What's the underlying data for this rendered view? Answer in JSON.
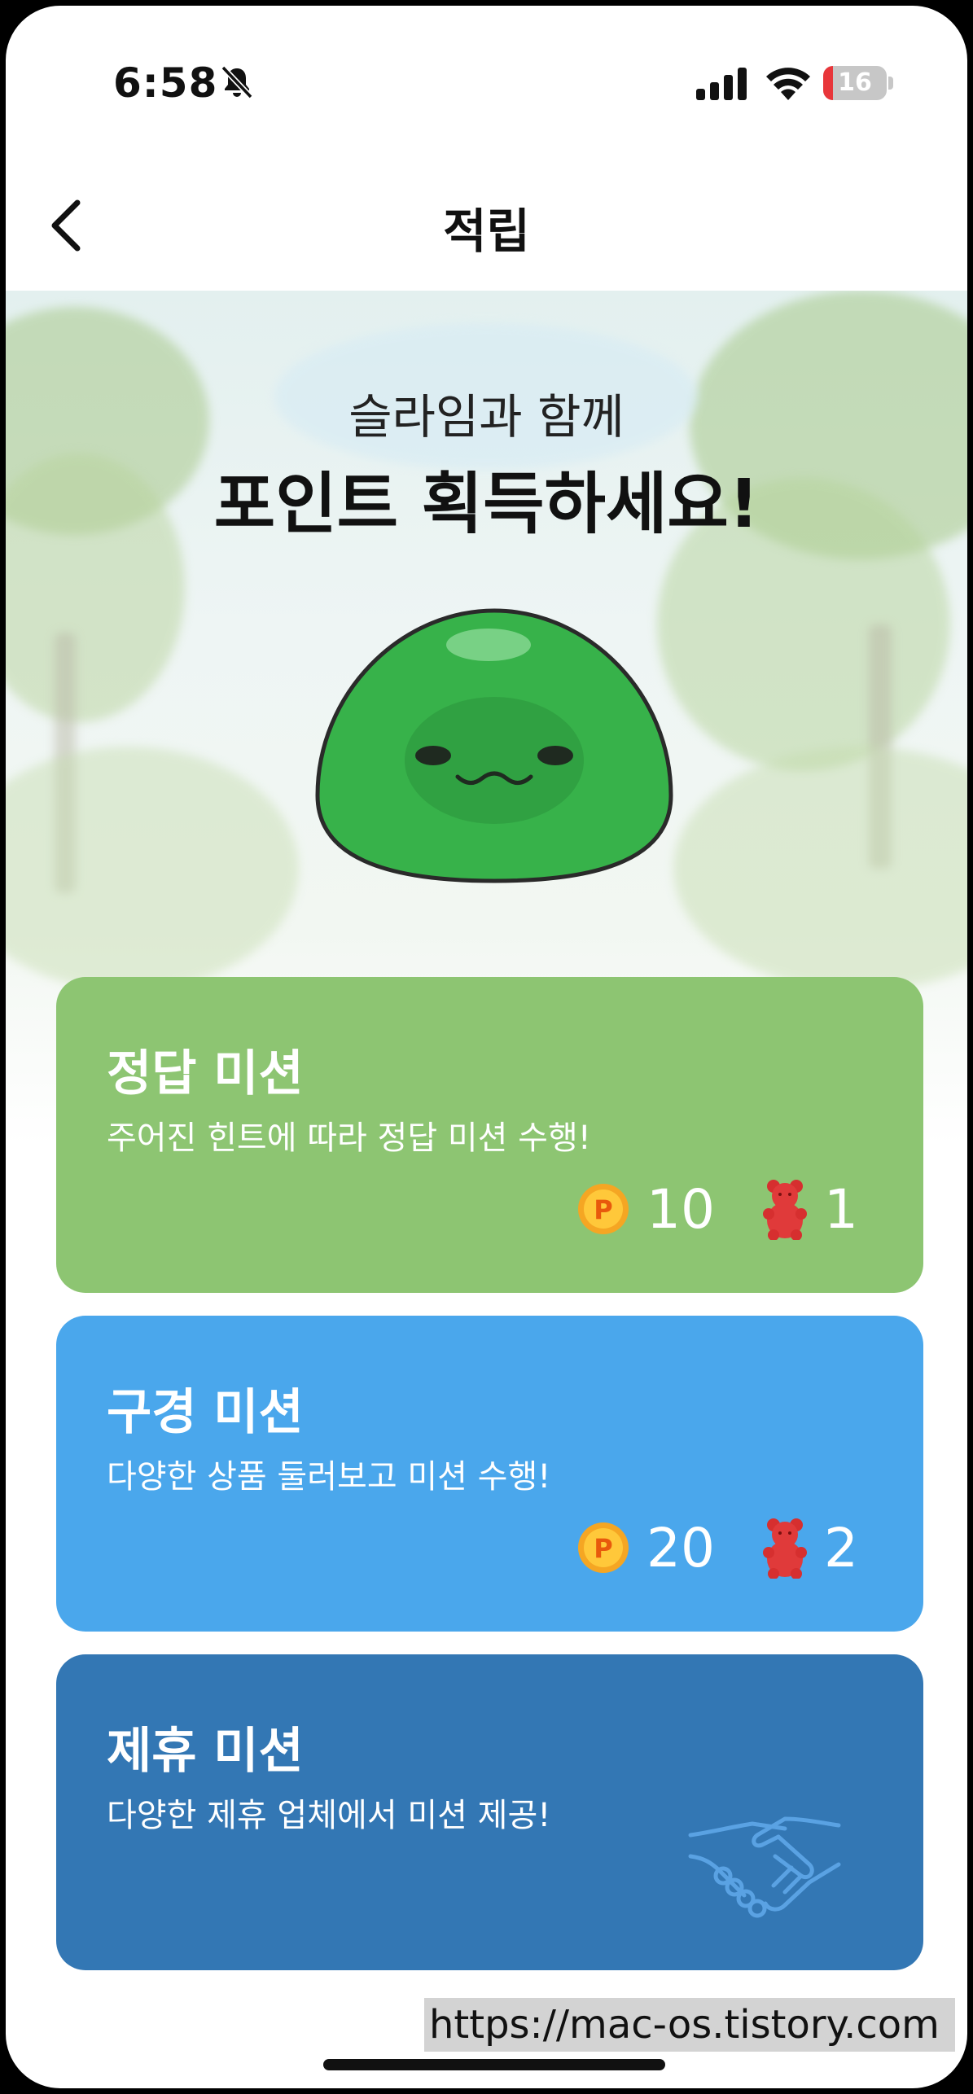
{
  "status_bar": {
    "time": "6:58",
    "battery": "16",
    "battery_level": 0.16
  },
  "nav": {
    "title": "적립",
    "back_icon": "chevron-left-icon"
  },
  "hero": {
    "subtitle": "슬라임과 함께",
    "title": "포인트 획득하세요!"
  },
  "missions": [
    {
      "title": "정답 미션",
      "description": "주어진 힌트에 따라 정답 미션 수행!",
      "points": "10",
      "bears": "1",
      "color": "#8dc572"
    },
    {
      "title": "구경 미션",
      "description": "다양한 상품 둘러보고 미션 수행!",
      "points": "20",
      "bears": "2",
      "color": "#4aa7ec"
    },
    {
      "title": "제휴 미션",
      "description": "다양한 제휴 업체에서 미션 제공!",
      "color": "#3377b4",
      "icon": "handshake-icon"
    }
  ],
  "watermark": "https://mac-os.tistory.com"
}
